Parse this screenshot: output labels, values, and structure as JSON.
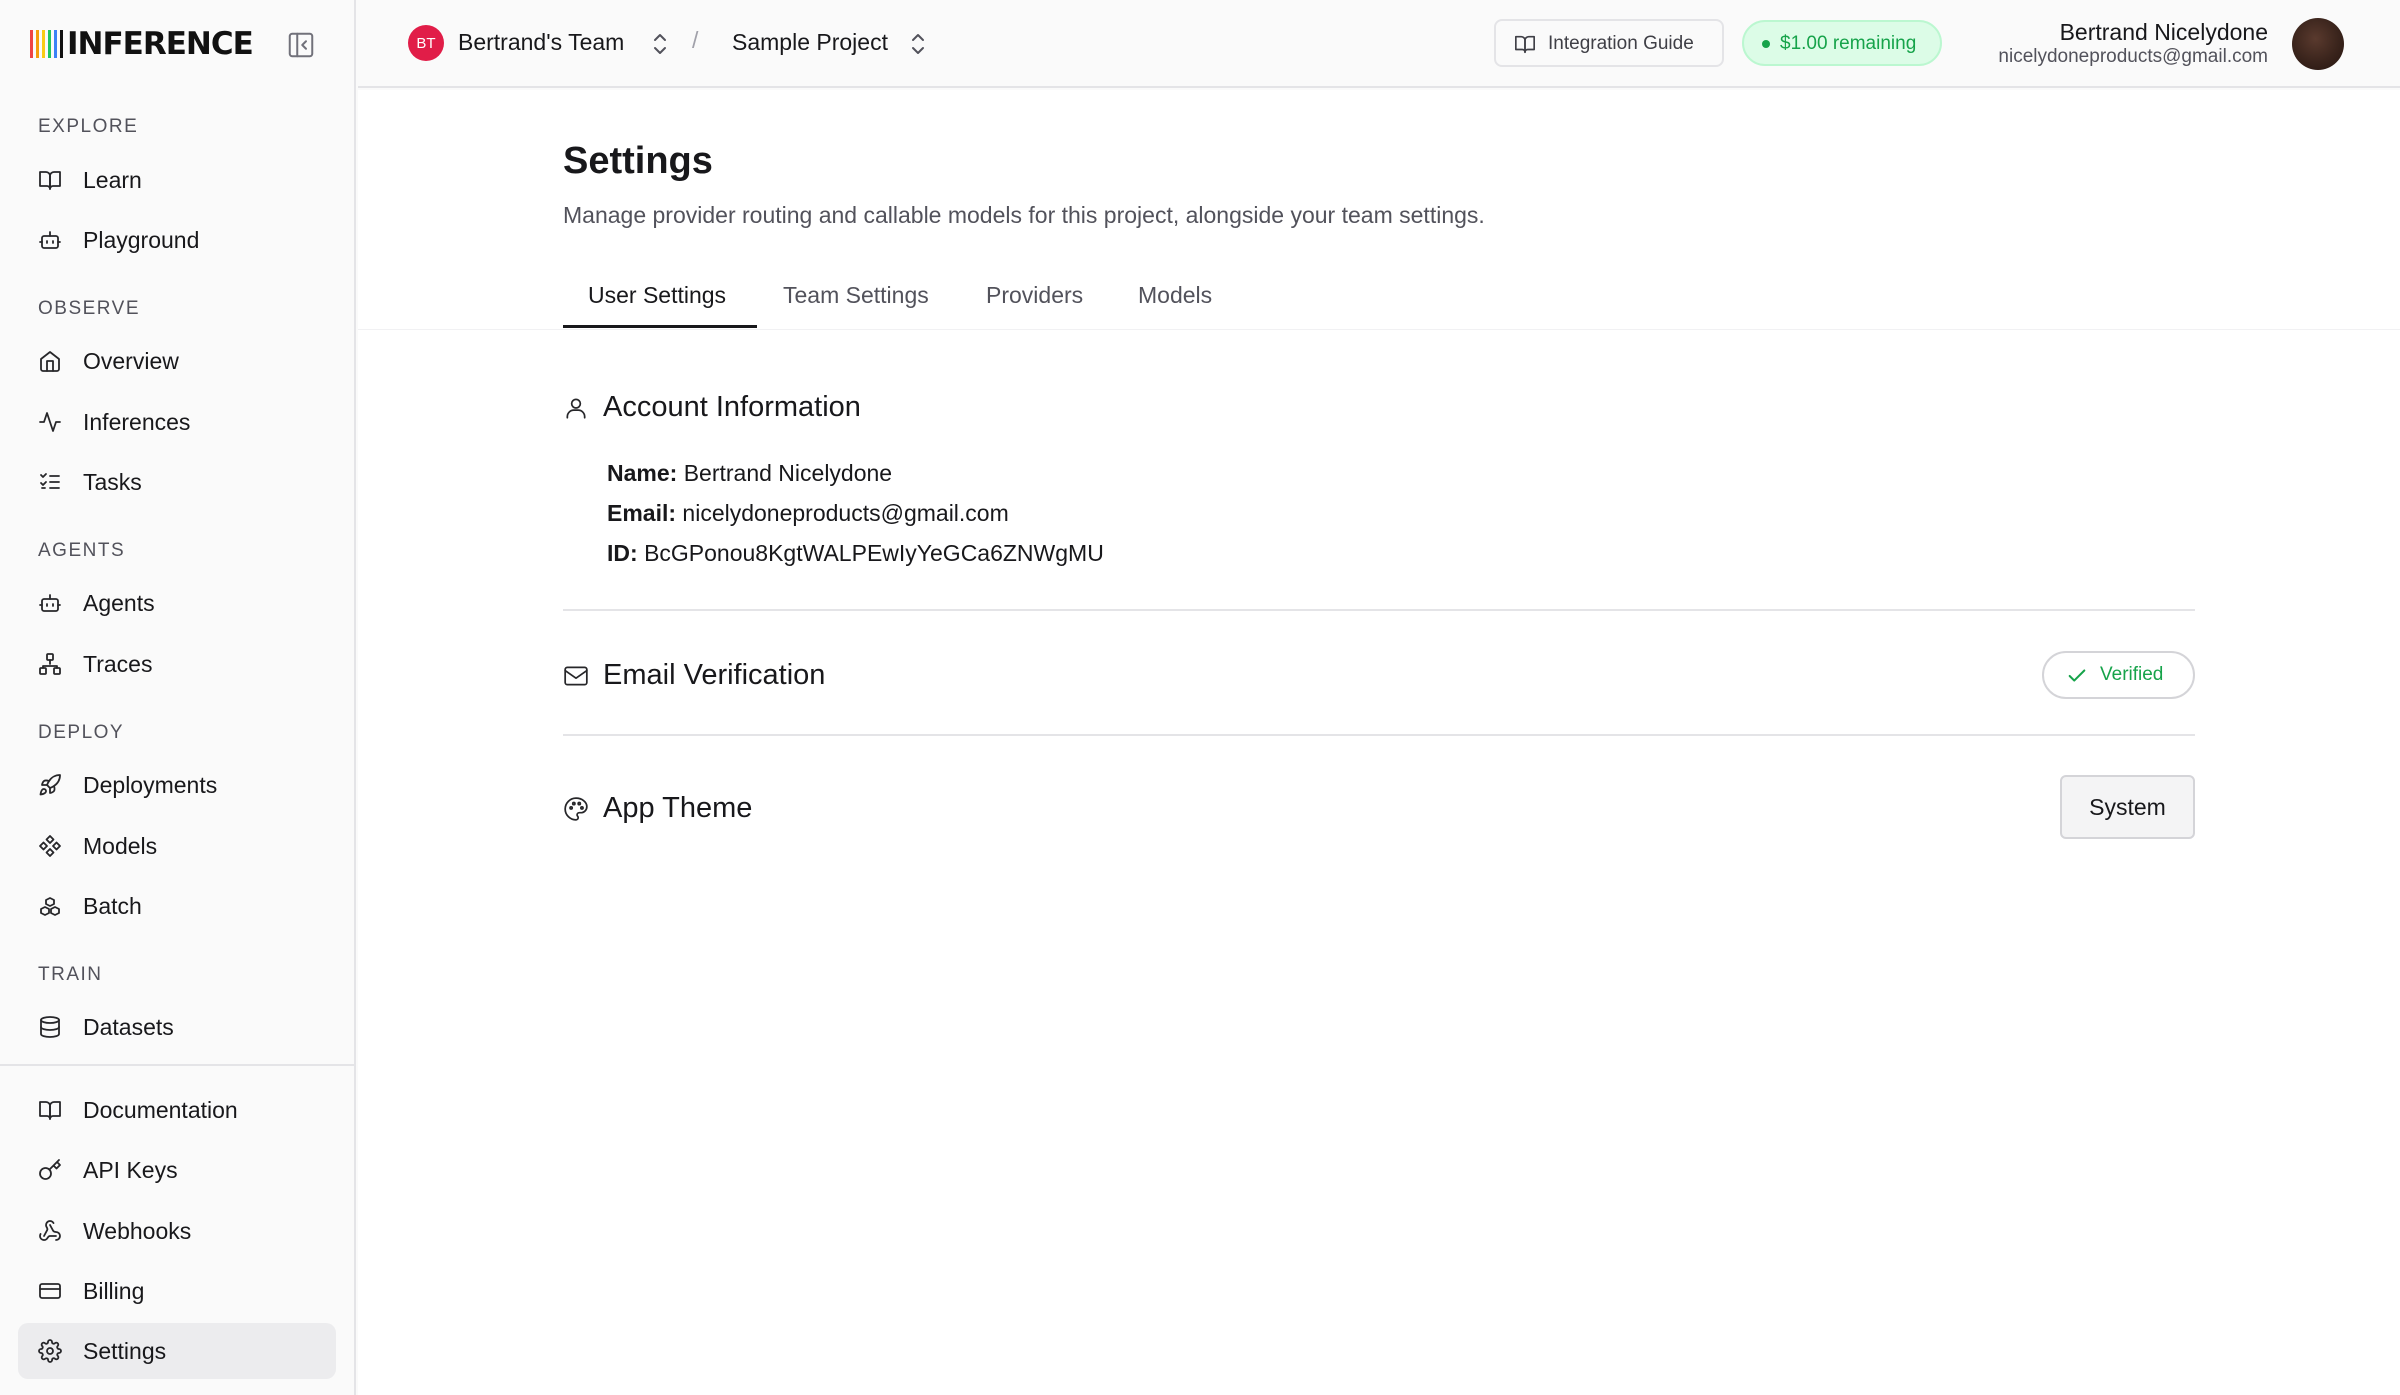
{
  "brand": {
    "name": "INFERENCE",
    "bar_colors": [
      "#ef4444",
      "#f59e0b",
      "#facc15",
      "#22c55e",
      "#3b82f6",
      "#8b5cf6"
    ]
  },
  "sidebar": {
    "sections": {
      "explore": "EXPLORE",
      "observe": "OBSERVE",
      "agents": "AGENTS",
      "deploy": "DEPLOY",
      "train": "TRAIN"
    },
    "items": {
      "learn": {
        "label": "Learn",
        "icon": "book-open-icon"
      },
      "playground": {
        "label": "Playground",
        "icon": "bot-icon"
      },
      "overview": {
        "label": "Overview",
        "icon": "home-icon"
      },
      "inferences": {
        "label": "Inferences",
        "icon": "activity-icon"
      },
      "tasks": {
        "label": "Tasks",
        "icon": "list-checks-icon"
      },
      "agents": {
        "label": "Agents",
        "icon": "bot-icon"
      },
      "traces": {
        "label": "Traces",
        "icon": "workflow-icon"
      },
      "deployments": {
        "label": "Deployments",
        "icon": "rocket-icon"
      },
      "models": {
        "label": "Models",
        "icon": "component-icon"
      },
      "batch": {
        "label": "Batch",
        "icon": "boxes-icon"
      },
      "datasets": {
        "label": "Datasets",
        "icon": "database-icon"
      },
      "documentation": {
        "label": "Documentation",
        "icon": "book-open-icon"
      },
      "api_keys": {
        "label": "API Keys",
        "icon": "key-icon"
      },
      "webhooks": {
        "label": "Webhooks",
        "icon": "webhook-icon"
      },
      "billing": {
        "label": "Billing",
        "icon": "credit-card-icon"
      },
      "settings": {
        "label": "Settings",
        "icon": "gear-icon",
        "active": true
      }
    }
  },
  "topbar": {
    "team_initials": "BT",
    "team_name": "Bertrand's Team",
    "separator": "/",
    "project_name": "Sample Project",
    "integration_guide": "Integration Guide",
    "credits": "$1.00 remaining",
    "user_name": "Bertrand Nicelydone",
    "user_email": "nicelydoneproducts@gmail.com"
  },
  "page": {
    "title": "Settings",
    "subtitle": "Manage provider routing and callable models for this project, alongside your team settings.",
    "tabs": [
      "User Settings",
      "Team Settings",
      "Providers",
      "Models"
    ],
    "active_tab": "User Settings"
  },
  "account": {
    "title": "Account Information",
    "name_label": "Name:",
    "name": "Bertrand Nicelydone",
    "email_label": "Email:",
    "email": "nicelydoneproducts@gmail.com",
    "id_label": "ID:",
    "id": "BcGPonou8KgtWALPEwIyYeGCa6ZNWgMU"
  },
  "email_verification": {
    "title": "Email Verification",
    "status": "Verified"
  },
  "app_theme": {
    "title": "App Theme",
    "value": "System"
  },
  "colors": {
    "accent_green": "#16a34a",
    "avatar_red": "#e11d48"
  }
}
